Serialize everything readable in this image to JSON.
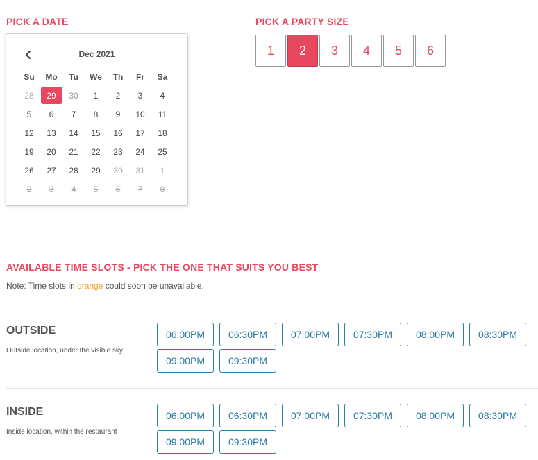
{
  "date_section": {
    "title": "PICK A DATE",
    "month_label": "Dec 2021",
    "weekdays": [
      "Su",
      "Mo",
      "Tu",
      "We",
      "Th",
      "Fr",
      "Sa"
    ],
    "days": [
      {
        "d": "28",
        "s": "disabled"
      },
      {
        "d": "29",
        "s": "selected"
      },
      {
        "d": "30",
        "s": "other"
      },
      {
        "d": "1",
        "s": ""
      },
      {
        "d": "2",
        "s": ""
      },
      {
        "d": "3",
        "s": ""
      },
      {
        "d": "4",
        "s": ""
      },
      {
        "d": "5",
        "s": ""
      },
      {
        "d": "6",
        "s": ""
      },
      {
        "d": "7",
        "s": ""
      },
      {
        "d": "8",
        "s": ""
      },
      {
        "d": "9",
        "s": ""
      },
      {
        "d": "10",
        "s": ""
      },
      {
        "d": "11",
        "s": ""
      },
      {
        "d": "12",
        "s": ""
      },
      {
        "d": "13",
        "s": ""
      },
      {
        "d": "14",
        "s": ""
      },
      {
        "d": "15",
        "s": ""
      },
      {
        "d": "16",
        "s": ""
      },
      {
        "d": "17",
        "s": ""
      },
      {
        "d": "18",
        "s": ""
      },
      {
        "d": "19",
        "s": ""
      },
      {
        "d": "20",
        "s": ""
      },
      {
        "d": "21",
        "s": ""
      },
      {
        "d": "22",
        "s": ""
      },
      {
        "d": "23",
        "s": ""
      },
      {
        "d": "24",
        "s": ""
      },
      {
        "d": "25",
        "s": ""
      },
      {
        "d": "26",
        "s": ""
      },
      {
        "d": "27",
        "s": ""
      },
      {
        "d": "28",
        "s": ""
      },
      {
        "d": "29",
        "s": ""
      },
      {
        "d": "30",
        "s": "disabled"
      },
      {
        "d": "31",
        "s": "disabled"
      },
      {
        "d": "1",
        "s": "disabled"
      },
      {
        "d": "2",
        "s": "disabled"
      },
      {
        "d": "3",
        "s": "disabled"
      },
      {
        "d": "4",
        "s": "disabled"
      },
      {
        "d": "5",
        "s": "disabled"
      },
      {
        "d": "6",
        "s": "disabled"
      },
      {
        "d": "7",
        "s": "disabled"
      },
      {
        "d": "8",
        "s": "disabled"
      }
    ]
  },
  "party_section": {
    "title": "PICK A PARTY SIZE",
    "sizes": [
      "1",
      "2",
      "3",
      "4",
      "5",
      "6"
    ],
    "selected": "2"
  },
  "slots_section": {
    "title": "AVAILABLE TIME SLOTS - PICK THE ONE THAT SUITS YOU BEST",
    "note_prefix": "Note: Time slots in ",
    "note_highlight": "orange",
    "note_suffix": " could soon be unavailable."
  },
  "locations": [
    {
      "name": "OUTSIDE",
      "description": "Outside location, under the visible sky",
      "slots": [
        "06:00PM",
        "06:30PM",
        "07:00PM",
        "07:30PM",
        "08:00PM",
        "08:30PM",
        "09:00PM",
        "09:30PM"
      ]
    },
    {
      "name": "INSIDE",
      "description": "Inside location, within the restaurant",
      "slots": [
        "06:00PM",
        "06:30PM",
        "07:00PM",
        "07:30PM",
        "08:00PM",
        "08:30PM",
        "09:00PM",
        "09:30PM"
      ]
    }
  ],
  "colors": {
    "accent": "#e8475d",
    "slot_blue": "#2a79a4",
    "warning_orange": "#f0a030"
  }
}
